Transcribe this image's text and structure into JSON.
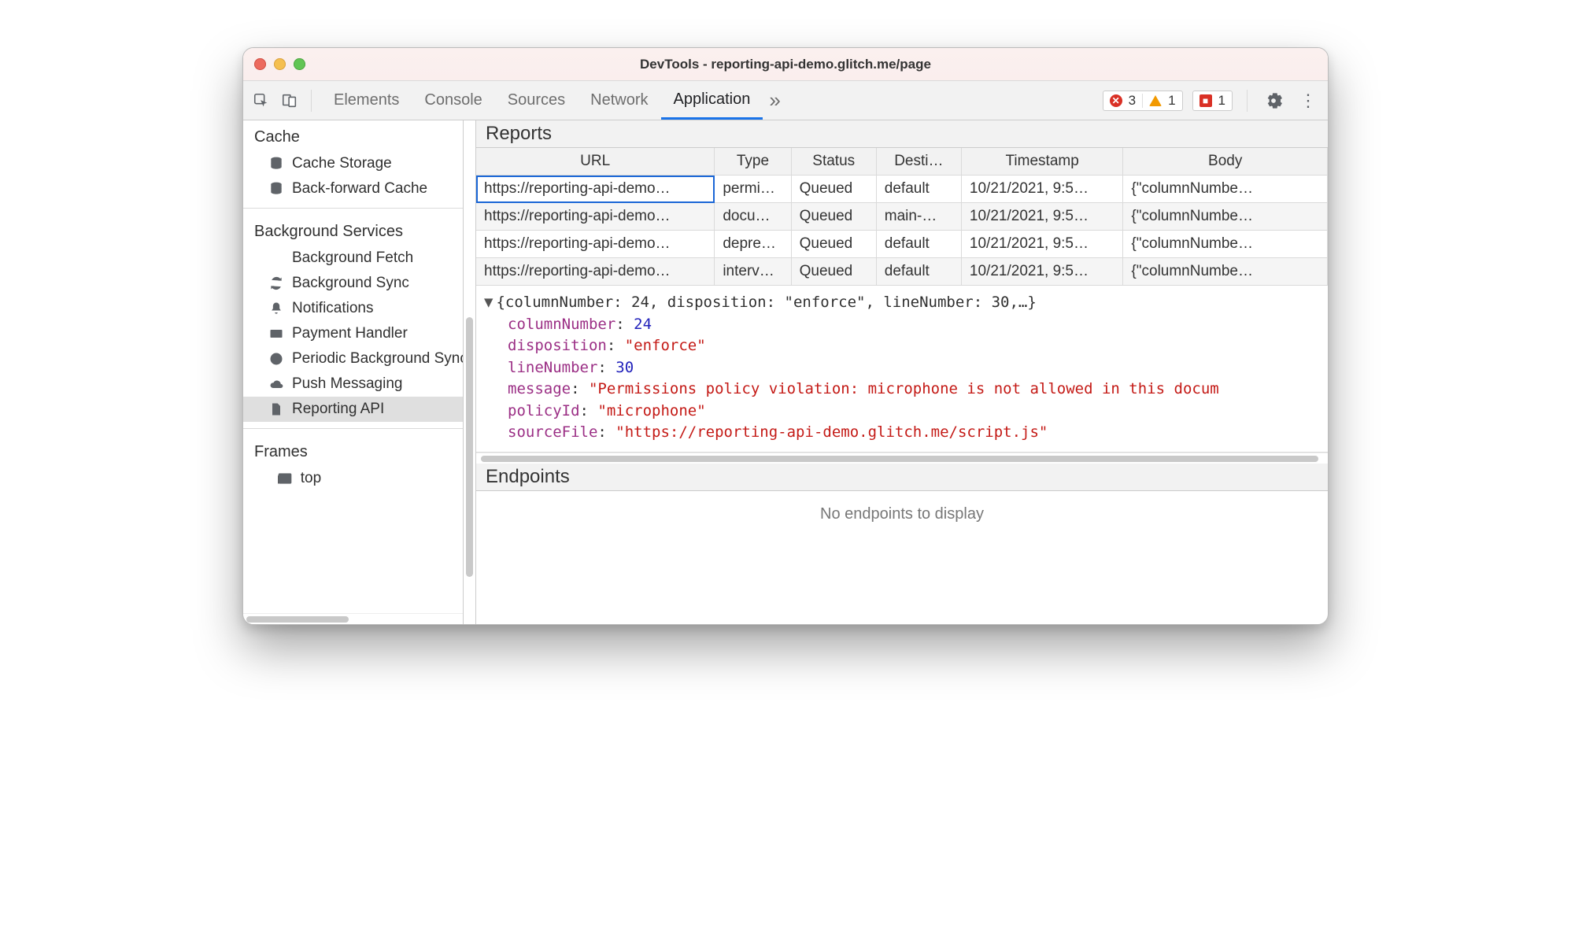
{
  "window_title": "DevTools - reporting-api-demo.glitch.me/page",
  "toolbar": {
    "tabs": [
      "Elements",
      "Console",
      "Sources",
      "Network",
      "Application"
    ],
    "active_tab": "Application",
    "errors_count": "3",
    "warnings_count": "1",
    "issues_count": "1"
  },
  "sidebar": {
    "sections": [
      {
        "title": "Cache",
        "items": [
          {
            "icon": "database-icon",
            "label": "Cache Storage"
          },
          {
            "icon": "database-icon",
            "label": "Back-forward Cache"
          }
        ]
      },
      {
        "title": "Background Services",
        "items": [
          {
            "icon": "fetch-icon",
            "label": "Background Fetch"
          },
          {
            "icon": "sync-icon",
            "label": "Background Sync"
          },
          {
            "icon": "bell-icon",
            "label": "Notifications"
          },
          {
            "icon": "card-icon",
            "label": "Payment Handler"
          },
          {
            "icon": "clock-icon",
            "label": "Periodic Background Sync"
          },
          {
            "icon": "cloud-icon",
            "label": "Push Messaging"
          },
          {
            "icon": "file-icon",
            "label": "Reporting API"
          }
        ],
        "selected": "Reporting API"
      },
      {
        "title": "Frames",
        "items": [
          {
            "icon": "window-icon",
            "label": "top",
            "has_toggle": true
          }
        ]
      }
    ]
  },
  "reports": {
    "section_title": "Reports",
    "columns": [
      "URL",
      "Type",
      "Status",
      "Desti…",
      "Timestamp",
      "Body"
    ],
    "rows": [
      {
        "url": "https://reporting-api-demo…",
        "type": "permi…",
        "status": "Queued",
        "dest": "default",
        "ts": "10/21/2021, 9:5…",
        "body": "{\"columnNumbe…"
      },
      {
        "url": "https://reporting-api-demo…",
        "type": "docu…",
        "status": "Queued",
        "dest": "main-…",
        "ts": "10/21/2021, 9:5…",
        "body": "{\"columnNumbe…"
      },
      {
        "url": "https://reporting-api-demo…",
        "type": "depre…",
        "status": "Queued",
        "dest": "default",
        "ts": "10/21/2021, 9:5…",
        "body": "{\"columnNumbe…"
      },
      {
        "url": "https://reporting-api-demo…",
        "type": "interv…",
        "status": "Queued",
        "dest": "default",
        "ts": "10/21/2021, 9:5…",
        "body": "{\"columnNumbe…"
      }
    ]
  },
  "detail": {
    "summary": "{columnNumber: 24, disposition: \"enforce\", lineNumber: 30,…}",
    "columnNumber": "24",
    "disposition": "\"enforce\"",
    "lineNumber": "30",
    "message": "\"Permissions policy violation: microphone is not allowed in this docum",
    "policyId": "\"microphone\"",
    "sourceFile": "\"https://reporting-api-demo.glitch.me/script.js\"",
    "keys": {
      "columnNumber": "columnNumber",
      "disposition": "disposition",
      "lineNumber": "lineNumber",
      "message": "message",
      "policyId": "policyId",
      "sourceFile": "sourceFile"
    }
  },
  "endpoints": {
    "section_title": "Endpoints",
    "empty_text": "No endpoints to display"
  }
}
